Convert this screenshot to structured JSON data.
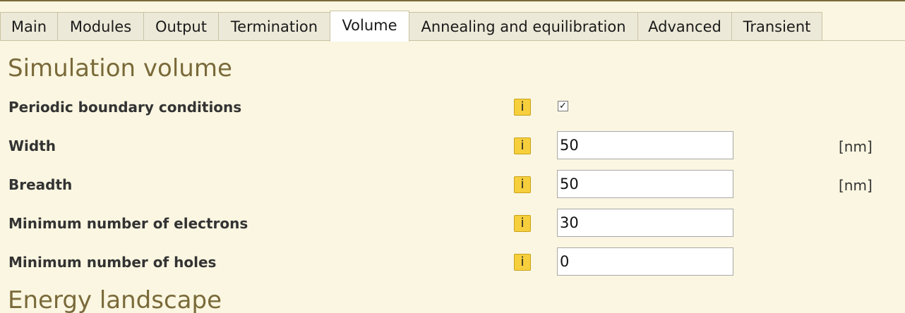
{
  "tabs": [
    {
      "label": "Main",
      "active": false
    },
    {
      "label": "Modules",
      "active": false
    },
    {
      "label": "Output",
      "active": false
    },
    {
      "label": "Termination",
      "active": false
    },
    {
      "label": "Volume",
      "active": true
    },
    {
      "label": "Annealing and equilibration",
      "active": false
    },
    {
      "label": "Advanced",
      "active": false
    },
    {
      "label": "Transient",
      "active": false
    }
  ],
  "info_icon_glyph": "i",
  "sections": {
    "simulation_volume": {
      "title": "Simulation volume",
      "rows": [
        {
          "label": "Periodic boundary conditions",
          "type": "checkbox",
          "checked": true,
          "check_glyph": "✓"
        },
        {
          "label": "Width",
          "type": "text",
          "value": "50",
          "unit": "[nm]"
        },
        {
          "label": "Breadth",
          "type": "text",
          "value": "50",
          "unit": "[nm]"
        },
        {
          "label": "Minimum number of electrons",
          "type": "text",
          "value": "30"
        },
        {
          "label": "Minimum number of holes",
          "type": "text",
          "value": "0"
        }
      ]
    },
    "energy_landscape": {
      "title": "Energy landscape"
    }
  },
  "colors": {
    "background": "#faf6e1",
    "heading": "#7a6a3a",
    "info_icon": "#f7cf3c",
    "tab_inactive": "#ece9d8",
    "tab_active": "#ffffff"
  }
}
